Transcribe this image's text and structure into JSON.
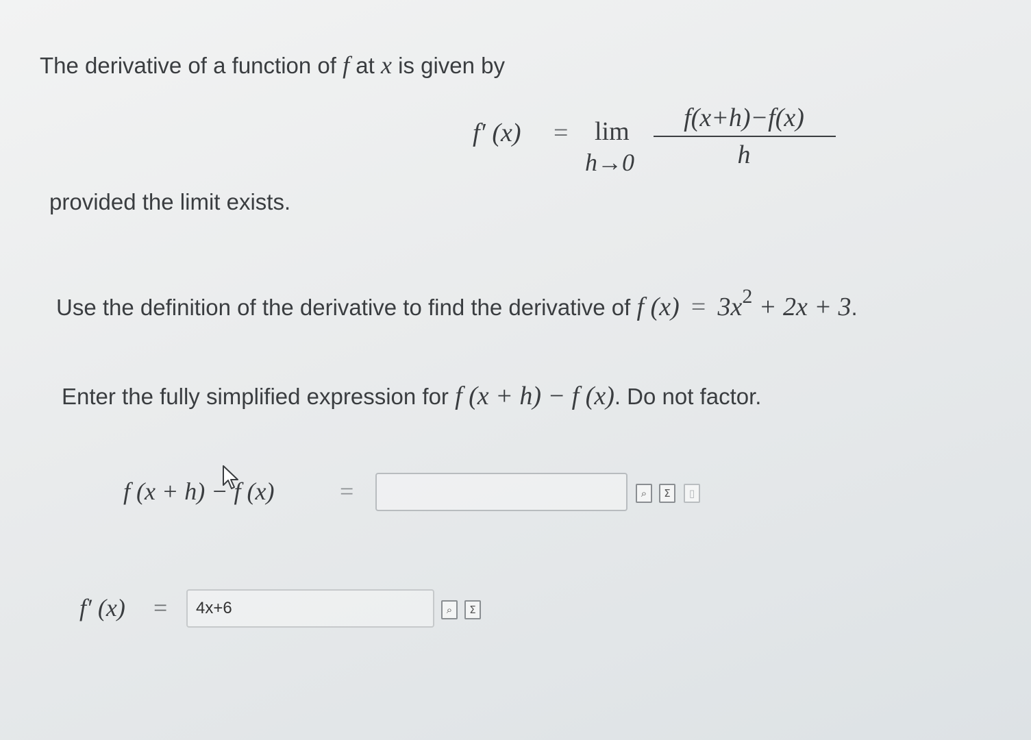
{
  "intro": {
    "text_before": "The derivative of a function of ",
    "var_f": "f",
    "text_at": " at ",
    "var_x": "x",
    "text_after": " is given by"
  },
  "definition": {
    "lhs": "f′ (x)",
    "equals": "=",
    "lim": "lim",
    "lim_sub": "h→0",
    "numerator": "f(x+h)−f(x)",
    "denominator": "h"
  },
  "proviso": "provided the limit exists.",
  "task": {
    "text": "Use the definition of the derivative to find the derivative of ",
    "function_lhs": "f (x)",
    "equals": "=",
    "function_rhs_a": "3x",
    "exponent": "2",
    "function_rhs_b": " + 2x + 3",
    "period": "."
  },
  "instruction": {
    "text": "Enter the fully simplified expression for ",
    "expr": "f (x + h) − f (x)",
    "text_after": ". Do not factor."
  },
  "answer1": {
    "label": "f (x + h) − f (x)",
    "equals": "=",
    "value": ""
  },
  "answer2": {
    "label": "f′ (x)",
    "equals": "=",
    "value": "4x+6"
  },
  "icons": {
    "preview": "preview-icon",
    "equation_editor": "sigma-icon",
    "help": "help-doc-icon"
  }
}
